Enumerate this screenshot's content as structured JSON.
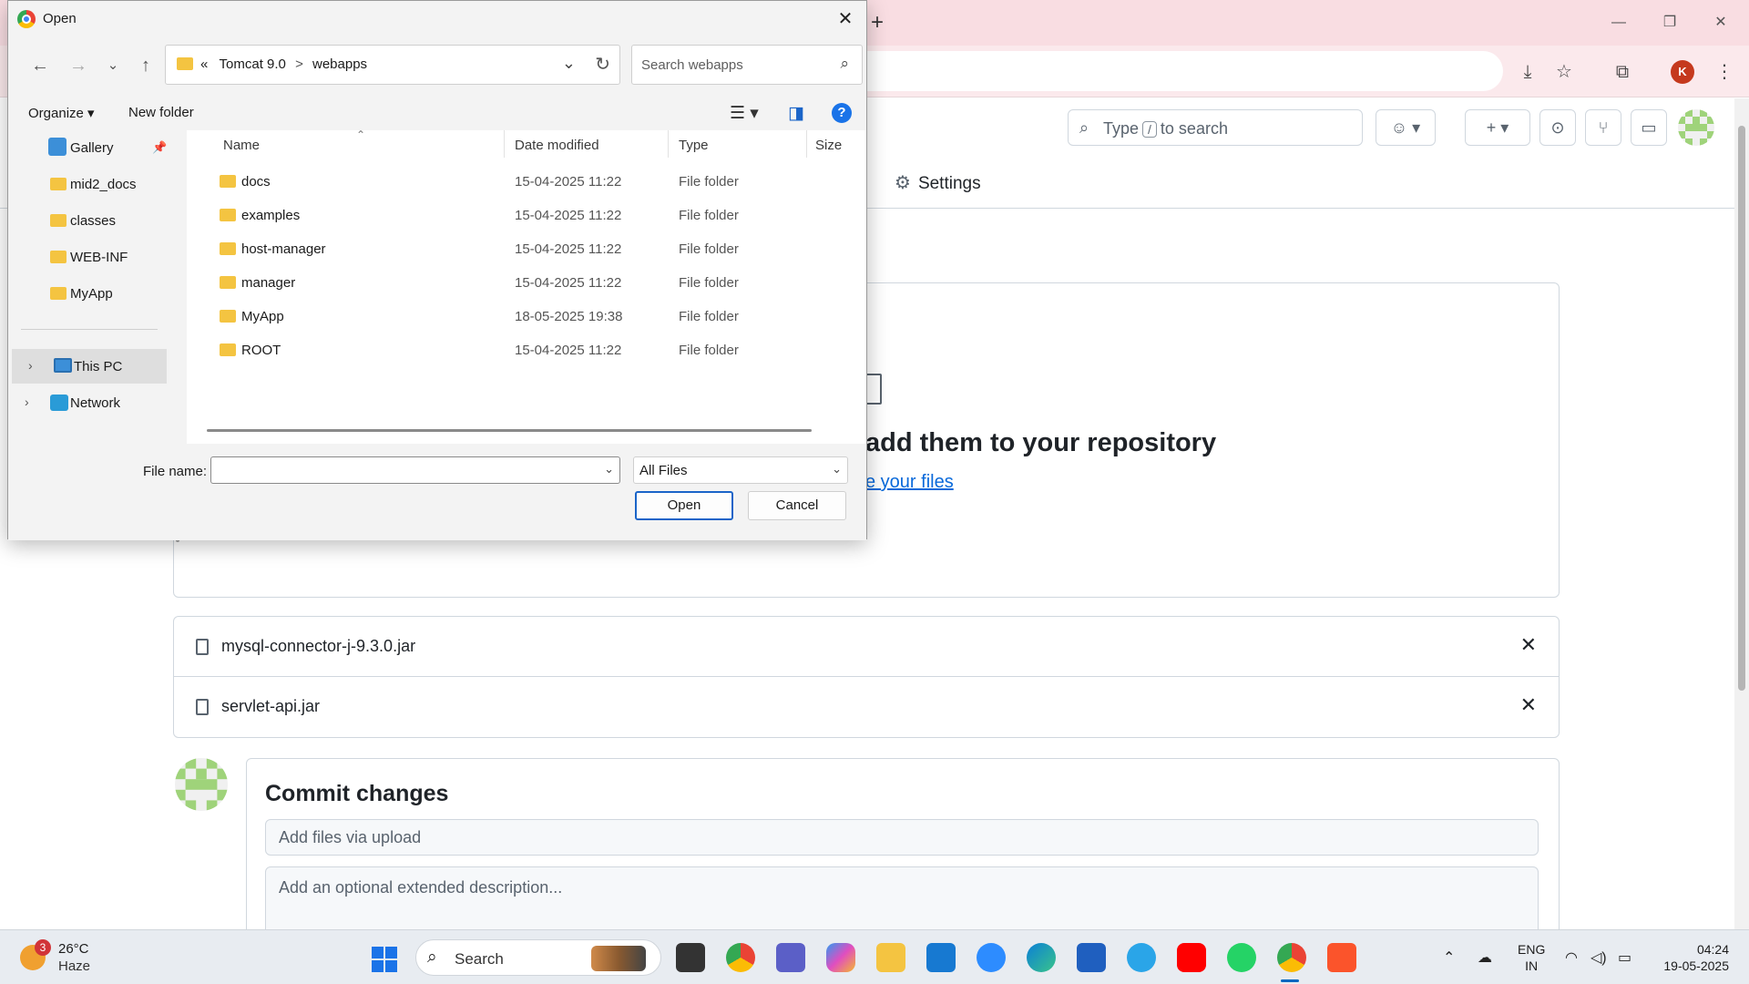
{
  "browser": {
    "new_tab": "+",
    "profile_initial": "K"
  },
  "github": {
    "search_prefix": "Type",
    "search_slash": "/",
    "search_suffix": "to search",
    "settings_tab": "Settings",
    "drop_title": "add them to your repository",
    "drop_link": "e your files",
    "files": [
      {
        "name": "mysql-connector-j-9.3.0.jar"
      },
      {
        "name": "servlet-api.jar"
      }
    ],
    "commit": {
      "title": "Commit changes",
      "summary_placeholder": "Add files via upload",
      "description_placeholder": "Add an optional extended description..."
    }
  },
  "dialog": {
    "title": "Open",
    "breadcrumb": {
      "chevrons": "«",
      "part1": "Tomcat 9.0",
      "separator": ">",
      "part2": "webapps"
    },
    "search_placeholder": "Search webapps",
    "organize": "Organize ▾",
    "new_folder": "New folder",
    "help": "?",
    "nav_items": [
      {
        "label": "Gallery"
      },
      {
        "label": "mid2_docs"
      },
      {
        "label": "classes"
      },
      {
        "label": "WEB-INF"
      },
      {
        "label": "MyApp"
      },
      {
        "label": "This PC"
      },
      {
        "label": "Network"
      }
    ],
    "columns": {
      "name": "Name",
      "date": "Date modified",
      "type": "Type",
      "size": "Size"
    },
    "rows": [
      {
        "name": "docs",
        "date": "15-04-2025 11:22",
        "type": "File folder"
      },
      {
        "name": "examples",
        "date": "15-04-2025 11:22",
        "type": "File folder"
      },
      {
        "name": "host-manager",
        "date": "15-04-2025 11:22",
        "type": "File folder"
      },
      {
        "name": "manager",
        "date": "15-04-2025 11:22",
        "type": "File folder"
      },
      {
        "name": "MyApp",
        "date": "18-05-2025 19:38",
        "type": "File folder"
      },
      {
        "name": "ROOT",
        "date": "15-04-2025 11:22",
        "type": "File folder"
      }
    ],
    "file_name_label": "File name:",
    "file_name_value": "",
    "filter_value": "All Files",
    "open_button": "Open",
    "cancel_button": "Cancel"
  },
  "taskbar": {
    "weather_badge": "3",
    "temperature": "26°C",
    "condition": "Haze",
    "search_label": "Search",
    "lang_line1": "ENG",
    "lang_line2": "IN",
    "time": "04:24",
    "date": "19-05-2025",
    "apps": [
      "chrome",
      "teams",
      "copilot",
      "file-explorer",
      "myhp",
      "zoom",
      "edge",
      "store",
      "skype",
      "youtube",
      "whatsapp",
      "chrome-profile",
      "brave"
    ]
  },
  "colors": {
    "browser_titlebar": "#f9dde2",
    "accent_blue": "#0969da",
    "folder_yellow": "#f4c441",
    "profile_red": "#c5391d"
  }
}
